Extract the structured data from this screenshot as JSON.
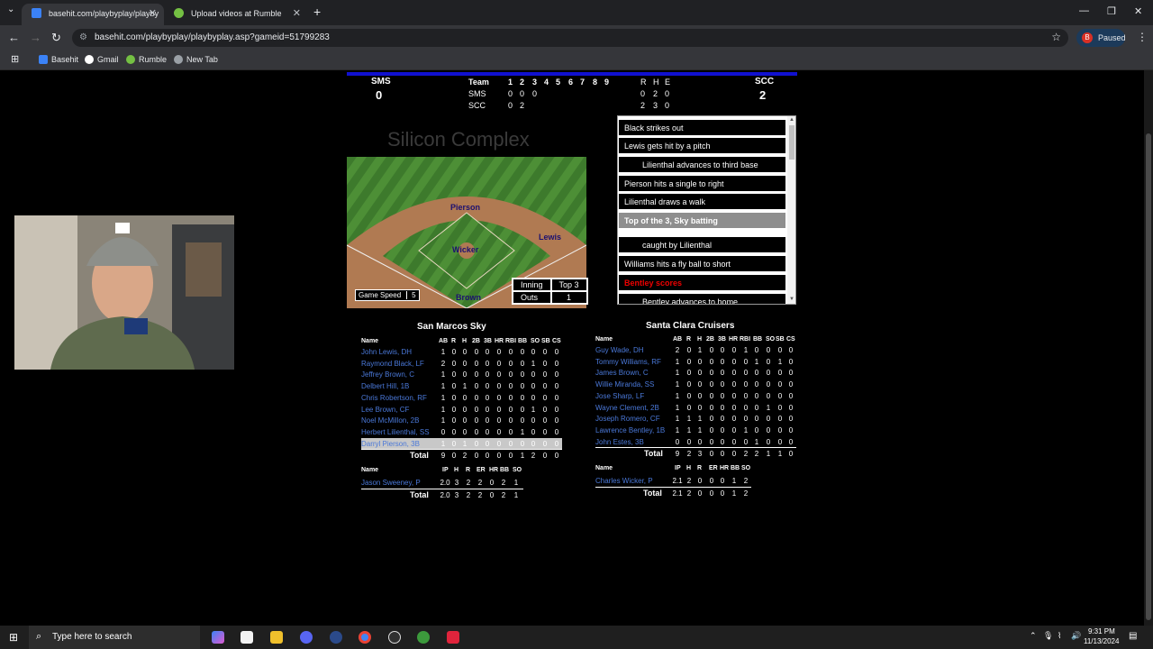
{
  "browser": {
    "tabs": [
      {
        "title": "basehit.com/playbyplay/playby",
        "active": true
      },
      {
        "title": "Upload videos at Rumble",
        "active": false
      }
    ],
    "new_tab": "+",
    "window_controls": {
      "minimize": "—",
      "maximize": "❐",
      "close": "✕"
    },
    "url": "basehit.com/playbyplay/playbyplay.asp?gameid=51799283",
    "profile": {
      "initial": "B",
      "label": "Paused"
    },
    "bookmarks": [
      "Basehit",
      "Gmail",
      "Rumble",
      "New Tab"
    ]
  },
  "linescore": {
    "away_abbr": "SMS",
    "away_score": "0",
    "home_abbr": "SCC",
    "home_score": "2",
    "team_header": "Team",
    "innings": [
      "1",
      "2",
      "3",
      "4",
      "5",
      "6",
      "7",
      "8",
      "9"
    ],
    "rhe_header": [
      "R",
      "H",
      "E"
    ],
    "rows": [
      {
        "team": "SMS",
        "runs": [
          "0",
          "0",
          "0"
        ],
        "rhe": [
          "0",
          "2",
          "0"
        ]
      },
      {
        "team": "SCC",
        "runs": [
          "0",
          "2"
        ],
        "rhe": [
          "2",
          "3",
          "0"
        ]
      }
    ]
  },
  "field": {
    "stadium": "Silicon Complex",
    "players": {
      "cf": "Pierson",
      "p": "Wicker",
      "rf": "Lewis",
      "c": "Brown"
    },
    "inning_label": "Inning",
    "inning_value": "Top 3",
    "outs_label": "Outs",
    "outs_value": "1",
    "speed_label": "Game Speed",
    "speed_value": "5"
  },
  "play_by_play": [
    {
      "text": "Black strikes out",
      "kind": "normal"
    },
    {
      "text": "Lewis gets hit by a pitch",
      "kind": "normal"
    },
    {
      "text": "Lilienthal advances to third base",
      "kind": "indent"
    },
    {
      "text": "Pierson hits a single to right",
      "kind": "normal"
    },
    {
      "text": "Lilienthal draws a walk",
      "kind": "normal"
    },
    {
      "text": "Top of the 3, Sky batting",
      "kind": "head"
    },
    {
      "text": "caught by Lilienthal",
      "kind": "indent"
    },
    {
      "text": "Williams hits a fly ball to short",
      "kind": "normal"
    },
    {
      "text": "Bentley scores",
      "kind": "score"
    },
    {
      "text": "Bentley advances to home",
      "kind": "indent"
    }
  ],
  "away_box": {
    "team": "San Marcos Sky",
    "bat_headers": [
      "Name",
      "AB",
      "R",
      "H",
      "2B",
      "3B",
      "HR",
      "RBI",
      "BB",
      "SO",
      "SB",
      "CS"
    ],
    "batters": [
      {
        "name": "John Lewis, DH",
        "stats": [
          "1",
          "0",
          "0",
          "0",
          "0",
          "0",
          "0",
          "0",
          "0",
          "0",
          "0"
        ]
      },
      {
        "name": "Raymond Black, LF",
        "stats": [
          "2",
          "0",
          "0",
          "0",
          "0",
          "0",
          "0",
          "0",
          "1",
          "0",
          "0"
        ]
      },
      {
        "name": "Jeffrey Brown, C",
        "stats": [
          "1",
          "0",
          "0",
          "0",
          "0",
          "0",
          "0",
          "0",
          "0",
          "0",
          "0"
        ]
      },
      {
        "name": "Delbert Hill, 1B",
        "stats": [
          "1",
          "0",
          "1",
          "0",
          "0",
          "0",
          "0",
          "0",
          "0",
          "0",
          "0"
        ]
      },
      {
        "name": "Chris Robertson, RF",
        "stats": [
          "1",
          "0",
          "0",
          "0",
          "0",
          "0",
          "0",
          "0",
          "0",
          "0",
          "0"
        ]
      },
      {
        "name": "Lee Brown, CF",
        "stats": [
          "1",
          "0",
          "0",
          "0",
          "0",
          "0",
          "0",
          "0",
          "1",
          "0",
          "0"
        ]
      },
      {
        "name": "Noel McMillon, 2B",
        "stats": [
          "1",
          "0",
          "0",
          "0",
          "0",
          "0",
          "0",
          "0",
          "0",
          "0",
          "0"
        ]
      },
      {
        "name": "Herbert Lilienthal, SS",
        "stats": [
          "0",
          "0",
          "0",
          "0",
          "0",
          "0",
          "0",
          "1",
          "0",
          "0",
          "0"
        ]
      },
      {
        "name": "Darryl Pierson, 3B",
        "stats": [
          "1",
          "0",
          "1",
          "0",
          "0",
          "0",
          "0",
          "0",
          "0",
          "0",
          "0"
        ]
      }
    ],
    "total_label": "Total",
    "bat_totals": [
      "9",
      "0",
      "2",
      "0",
      "0",
      "0",
      "0",
      "1",
      "2",
      "0",
      "0"
    ],
    "pit_headers": [
      "Name",
      "IP",
      "H",
      "R",
      "ER",
      "HR",
      "BB",
      "SO"
    ],
    "pitchers": [
      {
        "name": "Jason Sweeney, P",
        "stats": [
          "2.0",
          "3",
          "2",
          "2",
          "0",
          "2",
          "1"
        ]
      }
    ],
    "pit_totals": [
      "2.0",
      "3",
      "2",
      "2",
      "0",
      "2",
      "1"
    ]
  },
  "home_box": {
    "team": "Santa Clara Cruisers",
    "bat_headers": [
      "Name",
      "AB",
      "R",
      "H",
      "2B",
      "3B",
      "HR",
      "RBI",
      "BB",
      "SO",
      "SB",
      "CS"
    ],
    "batters": [
      {
        "name": "Guy Wade, DH",
        "stats": [
          "2",
          "0",
          "1",
          "0",
          "0",
          "0",
          "1",
          "0",
          "0",
          "0",
          "0"
        ]
      },
      {
        "name": "Tommy Williams, RF",
        "stats": [
          "1",
          "0",
          "0",
          "0",
          "0",
          "0",
          "0",
          "1",
          "0",
          "1",
          "0"
        ]
      },
      {
        "name": "James Brown, C",
        "stats": [
          "1",
          "0",
          "0",
          "0",
          "0",
          "0",
          "0",
          "0",
          "0",
          "0",
          "0"
        ]
      },
      {
        "name": "Willie Miranda, SS",
        "stats": [
          "1",
          "0",
          "0",
          "0",
          "0",
          "0",
          "0",
          "0",
          "0",
          "0",
          "0"
        ]
      },
      {
        "name": "Jose Sharp, LF",
        "stats": [
          "1",
          "0",
          "0",
          "0",
          "0",
          "0",
          "0",
          "0",
          "0",
          "0",
          "0"
        ]
      },
      {
        "name": "Wayne Clement, 2B",
        "stats": [
          "1",
          "0",
          "0",
          "0",
          "0",
          "0",
          "0",
          "0",
          "1",
          "0",
          "0"
        ]
      },
      {
        "name": "Joseph Romero, CF",
        "stats": [
          "1",
          "1",
          "1",
          "0",
          "0",
          "0",
          "0",
          "0",
          "0",
          "0",
          "0"
        ]
      },
      {
        "name": "Lawrence Bentley, 1B",
        "stats": [
          "1",
          "1",
          "1",
          "0",
          "0",
          "0",
          "1",
          "0",
          "0",
          "0",
          "0"
        ]
      },
      {
        "name": "John Estes, 3B",
        "stats": [
          "0",
          "0",
          "0",
          "0",
          "0",
          "0",
          "0",
          "1",
          "0",
          "0",
          "0"
        ]
      }
    ],
    "total_label": "Total",
    "bat_totals": [
      "9",
      "2",
      "3",
      "0",
      "0",
      "0",
      "2",
      "2",
      "1",
      "1",
      "0"
    ],
    "pit_headers": [
      "Name",
      "IP",
      "H",
      "R",
      "ER",
      "HR",
      "BB",
      "SO"
    ],
    "pitchers": [
      {
        "name": "Charles Wicker, P",
        "stats": [
          "2.1",
          "2",
          "0",
          "0",
          "0",
          "1",
          "2"
        ]
      }
    ],
    "pit_totals": [
      "2.1",
      "2",
      "0",
      "0",
      "0",
      "1",
      "2"
    ]
  },
  "taskbar": {
    "search_placeholder": "Type here to search",
    "time": "9:31 PM",
    "date": "11/13/2024"
  }
}
